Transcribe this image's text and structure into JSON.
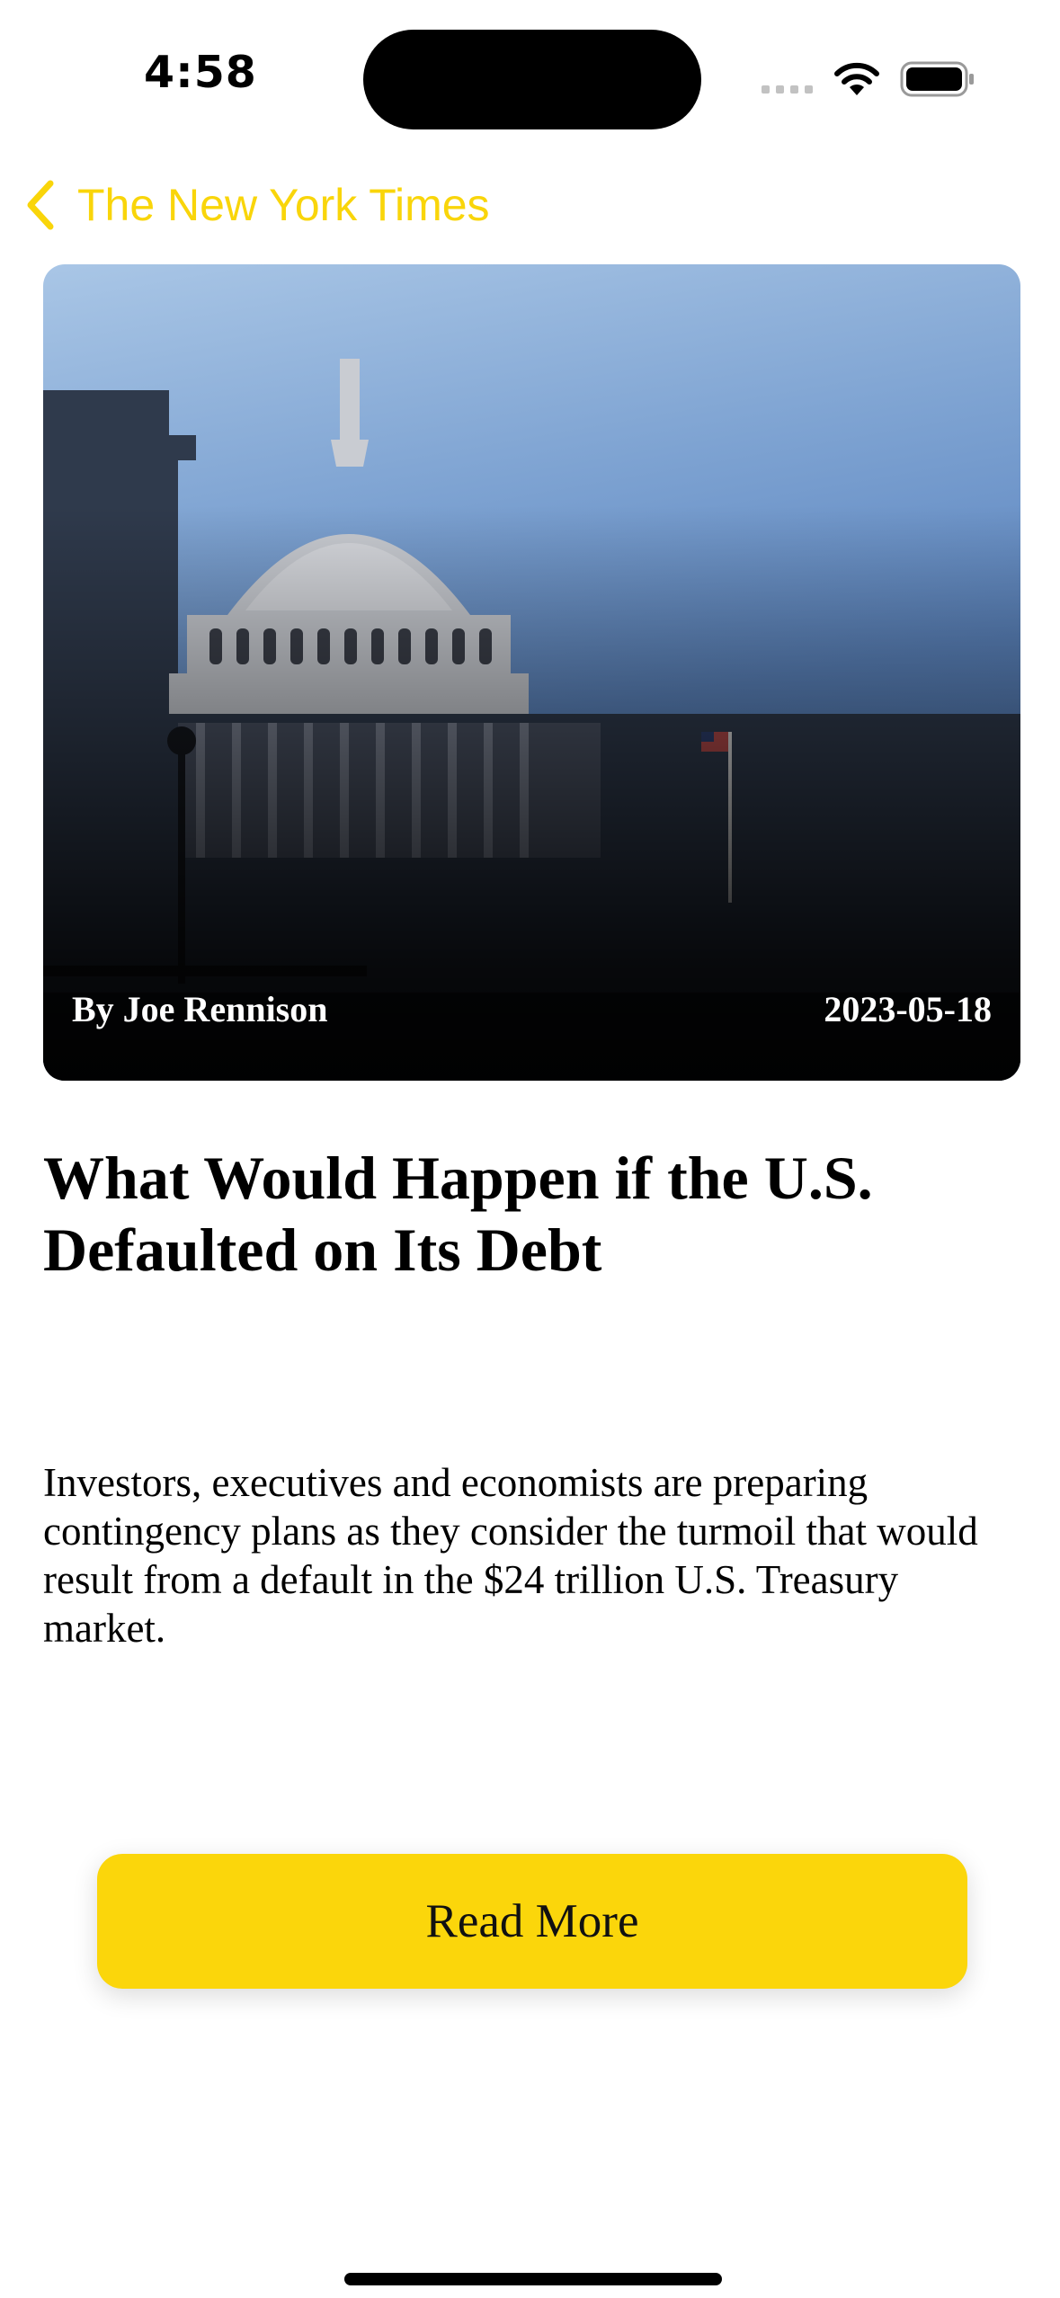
{
  "status_bar": {
    "time": "4:58",
    "icons": [
      "cellular-signal-icon",
      "wifi-icon",
      "battery-icon"
    ]
  },
  "nav": {
    "back_label": "The New York Times",
    "back_icon": "chevron-left-icon",
    "accent_color": "#F9D50A"
  },
  "article": {
    "image_subject": "capitol-dome-photo",
    "author": "By Joe Rennison",
    "date": "2023-05-18",
    "title": "What Would Happen if the U.S. Defaulted on Its Debt",
    "summary": "Investors, executives and economists are preparing contingency plans as they consider the turmoil that would result from a default in the $24 trillion U.S. Treasury market.",
    "read_more_label": "Read More",
    "button_color": "#FBD60B"
  }
}
